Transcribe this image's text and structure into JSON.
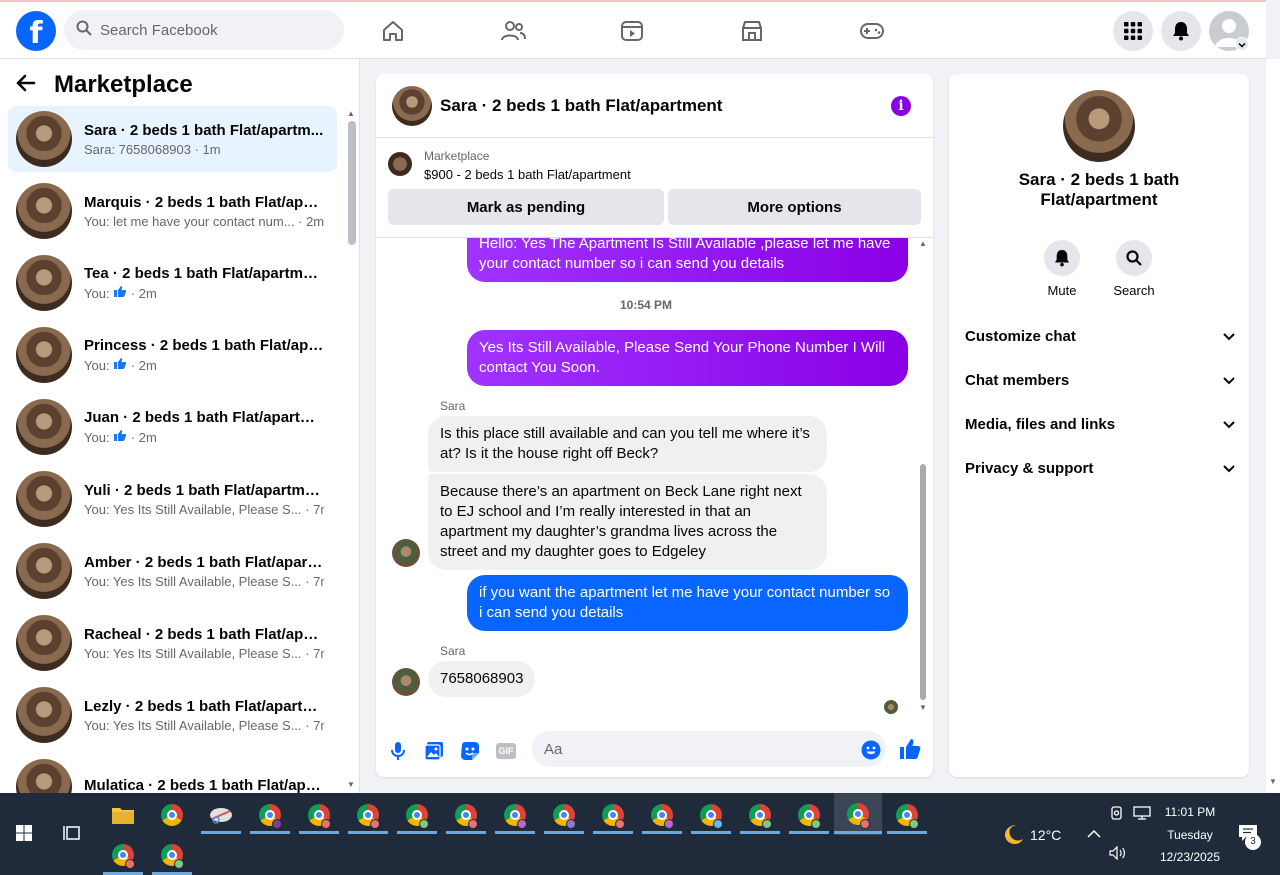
{
  "topnav": {
    "logo": "f",
    "search_placeholder": "Search Facebook"
  },
  "left_panel": {
    "title": "Marketplace",
    "conversations": [
      {
        "name": "Sara · 2 beds 1 bath Flat/apartm...",
        "preview": "Sara: 7658068903 · 1m",
        "active": true
      },
      {
        "name": "Marquis · 2 beds 1 bath Flat/apa...",
        "preview": "You: let me have your contact num... · 2m"
      },
      {
        "name": "Tea · 2 beds 1 bath Flat/apartment",
        "preview_prefix": "You: ",
        "preview_suffix": " · 2m"
      },
      {
        "name": "Princess · 2 beds 1 bath Flat/apa...",
        "preview_prefix": "You: ",
        "preview_suffix": " · 2m"
      },
      {
        "name": "Juan · 2 beds 1 bath Flat/apartm...",
        "preview_prefix": "You: ",
        "preview_suffix": " · 2m"
      },
      {
        "name": "Yuli · 2 beds 1 bath Flat/apartment",
        "preview": "You: Yes Its Still Available, Please S... · 7m"
      },
      {
        "name": "Amber · 2 beds 1 bath Flat/apart...",
        "preview": "You: Yes Its Still Available, Please S... · 7m"
      },
      {
        "name": "Racheal · 2 beds 1 bath Flat/apar...",
        "preview": "You: Yes Its Still Available, Please S... · 7m"
      },
      {
        "name": "Lezly · 2 beds 1 bath Flat/apartm...",
        "preview": "You: Yes Its Still Available, Please S... · 7m"
      },
      {
        "name": "Mulatica · 2 beds 1 bath Flat/apa...",
        "preview": ""
      }
    ]
  },
  "chat": {
    "title": "Sara · 2 beds 1 bath Flat/apartment",
    "info_icon": "i",
    "marketplace_label": "Marketplace",
    "listing": "$900 - 2 beds 1 bath Flat/apartment",
    "mark_pending": "Mark as pending",
    "more_options": "More options",
    "messages": {
      "m1": "Hello: Yes The Apartment Is Still Available ,please let me have your contact number so i can send you details",
      "time": "10:54 PM",
      "m2": "Yes Its Still Available, Please Send Your Phone Number I Will contact You Soon.",
      "sender1": "Sara",
      "m3": "Is this place still available and can you tell me where it’s at? Is it the house right off Beck?",
      "m4": "Because there’s an apartment on Beck Lane right next to EJ school and I’m really interested in that an apartment my daughter’s grandma lives across the street and my daughter goes to Edgeley",
      "m5": "if you want the apartment let me have your contact number so i can send you details",
      "sender2": "Sara",
      "m6": "7658068903"
    },
    "composer_placeholder": "Aa",
    "gif_label": "GIF"
  },
  "right_panel": {
    "title": "Sara · 2 beds 1 bath Flat/apartment",
    "mute": "Mute",
    "search": "Search",
    "sections": [
      "Customize chat",
      "Chat members",
      "Media, files and links",
      "Privacy & support"
    ]
  },
  "taskbar": {
    "temperature": "12°C",
    "time": "11:01 PM",
    "day": "Tuesday",
    "date": "12/23/2025",
    "notifications": "3"
  },
  "colors": {
    "brand_blue": "#0866ff",
    "purple_bubble": "#8a00e6",
    "taskbar": "#1f2b3a"
  }
}
